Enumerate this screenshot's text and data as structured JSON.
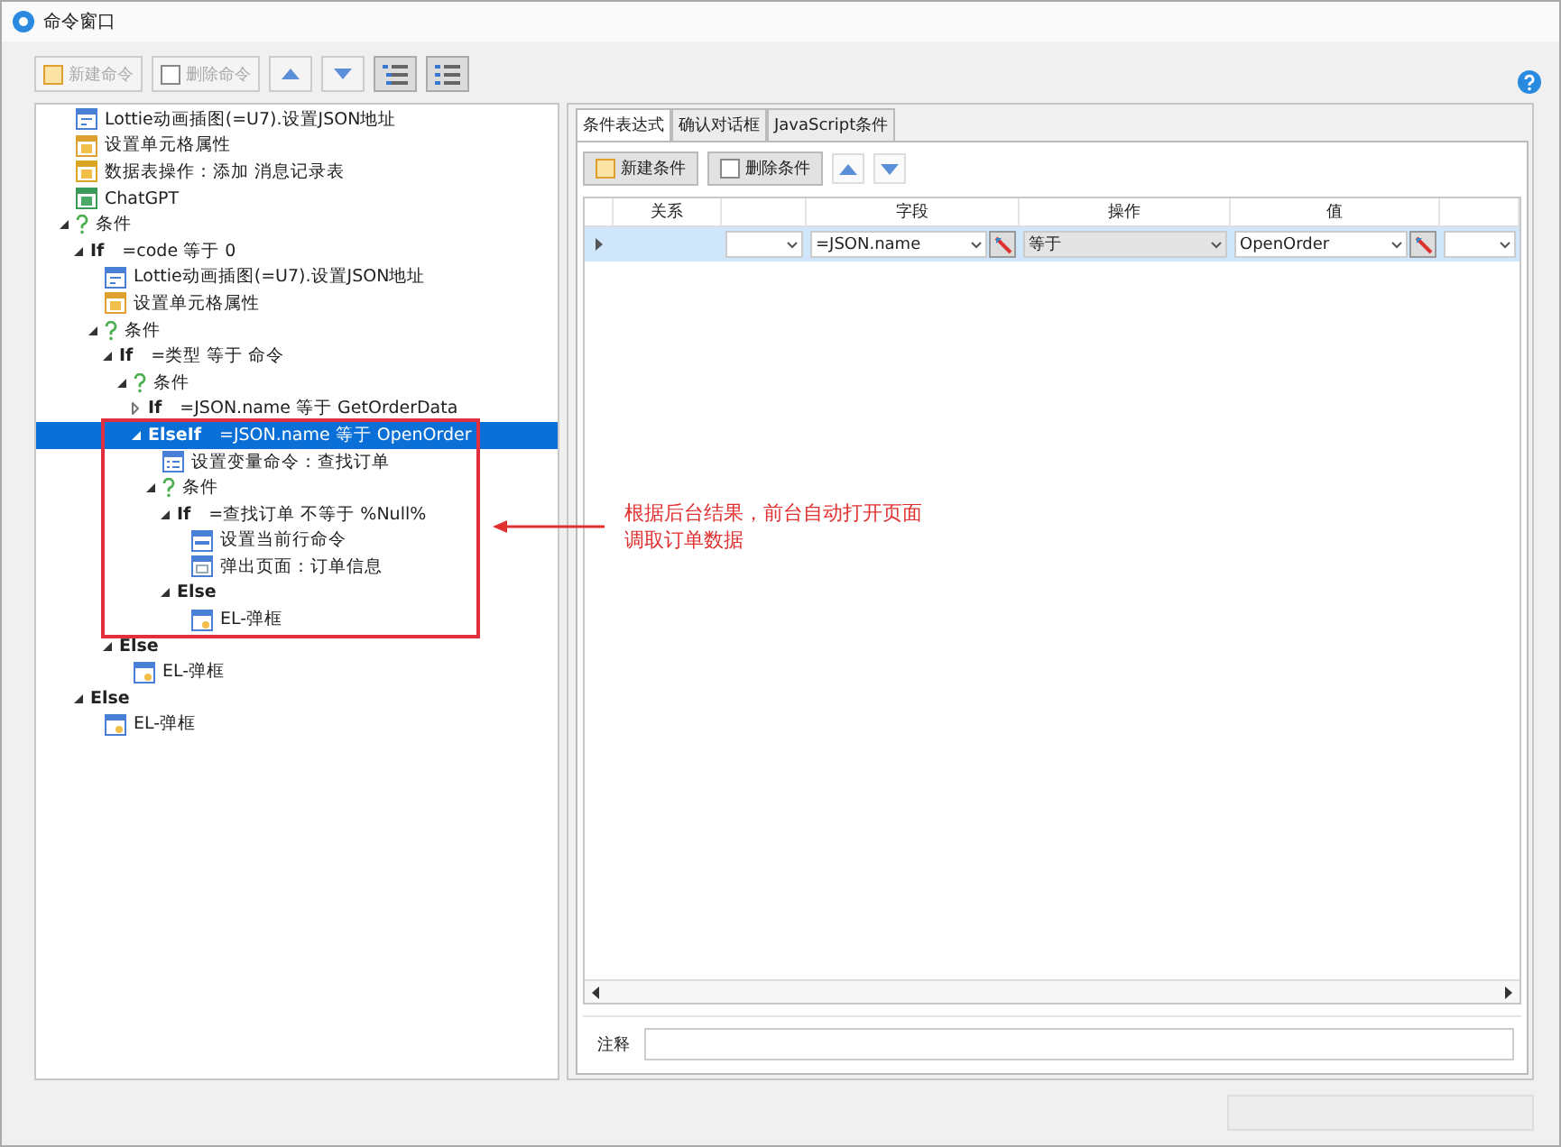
{
  "window": {
    "title": "命令窗口"
  },
  "toolbar": {
    "buttons": [
      {
        "kind": "new",
        "label": "新建命令",
        "disabled": true
      },
      {
        "kind": "delete",
        "label": "删除命令",
        "disabled": true
      },
      {
        "kind": "up"
      },
      {
        "kind": "down"
      },
      {
        "kind": "tree"
      },
      {
        "kind": "list"
      }
    ]
  },
  "tree": {
    "items": [
      {
        "kind": "lottie",
        "text": "Lottie动画插图(=U7).设置JSON地址",
        "selected": false
      },
      {
        "kind": "cell",
        "text": "设置单元格属性",
        "selected": false
      },
      {
        "kind": "db",
        "text": "数据表操作：添加 消息记录表",
        "selected": false
      },
      {
        "kind": "chat",
        "text": "ChatGPT",
        "selected": false
      },
      {
        "kind": "condition",
        "text": "条件",
        "selected": false,
        "expanded": true,
        "children": [
          {
            "kind": "branch",
            "keyword": "If",
            "text": "=code 等于 0",
            "selected": false,
            "expanded": true,
            "children": [
              {
                "kind": "lottie",
                "text": "Lottie动画插图(=U7).设置JSON地址",
                "selected": false
              },
              {
                "kind": "cell",
                "text": "设置单元格属性",
                "selected": false
              },
              {
                "kind": "condition",
                "text": "条件",
                "selected": false,
                "expanded": true,
                "children": [
                  {
                    "kind": "branch",
                    "keyword": "If",
                    "text": "=类型 等于 命令",
                    "selected": false,
                    "expanded": true,
                    "children": [
                      {
                        "kind": "condition",
                        "text": "条件",
                        "selected": false,
                        "expanded": true,
                        "children": [
                          {
                            "kind": "branch",
                            "keyword": "If",
                            "text": "=JSON.name 等于 GetOrderData",
                            "selected": false,
                            "expanded": false
                          },
                          {
                            "kind": "branch",
                            "keyword": "ElseIf",
                            "text": "=JSON.name 等于 OpenOrder",
                            "selected": true,
                            "expanded": true,
                            "children": [
                              {
                                "kind": "variable",
                                "text": "设置变量命令：查找订单",
                                "selected": false
                              },
                              {
                                "kind": "condition",
                                "text": "条件",
                                "selected": false,
                                "expanded": true,
                                "children": [
                                  {
                                    "kind": "branch",
                                    "keyword": "If",
                                    "text": "=查找订单 不等于 %Null%",
                                    "selected": false,
                                    "expanded": true,
                                    "children": [
                                      {
                                        "kind": "row",
                                        "text": "设置当前行命令",
                                        "selected": false
                                      },
                                      {
                                        "kind": "popup",
                                        "text": "弹出页面：订单信息",
                                        "selected": false
                                      }
                                    ]
                                  },
                                  {
                                    "kind": "branch",
                                    "keyword": "Else",
                                    "selected": false,
                                    "expanded": true,
                                    "children": [
                                      {
                                        "kind": "dialog",
                                        "text": "EL-弹框",
                                        "selected": false
                                      }
                                    ]
                                  }
                                ]
                              }
                            ]
                          }
                        ]
                      }
                    ]
                  },
                  {
                    "kind": "branch",
                    "keyword": "Else",
                    "selected": false,
                    "expanded": true,
                    "children": [
                      {
                        "kind": "dialog",
                        "text": "EL-弹框",
                        "selected": false
                      }
                    ]
                  }
                ]
              }
            ]
          },
          {
            "kind": "branch",
            "keyword": "Else",
            "selected": false,
            "expanded": true,
            "children": [
              {
                "kind": "dialog",
                "text": "EL-弹框",
                "selected": false
              }
            ]
          }
        ]
      }
    ]
  },
  "annotation": {
    "text": "根据后台结果，前台自动打开页面调取订单数据"
  },
  "tabs": [
    {
      "label": "条件表达式",
      "selected": true
    },
    {
      "label": "确认对话框",
      "selected": false
    },
    {
      "label": "JavaScript条件",
      "selected": false
    }
  ],
  "condition_toolbar": {
    "buttons": [
      {
        "kind": "new",
        "label": "新建条件"
      },
      {
        "kind": "delete",
        "label": "删除条件"
      },
      {
        "kind": "up"
      },
      {
        "kind": "down"
      }
    ]
  },
  "grid": {
    "columns": [
      "关系",
      "",
      "字段",
      "操作",
      "值",
      ""
    ],
    "rows": [
      {
        "selected": true,
        "relation": "",
        "field": "=JSON.name",
        "operator": "等于",
        "value": "OpenOrder",
        "column_6": ""
      }
    ]
  },
  "note": {
    "label": "注释"
  }
}
